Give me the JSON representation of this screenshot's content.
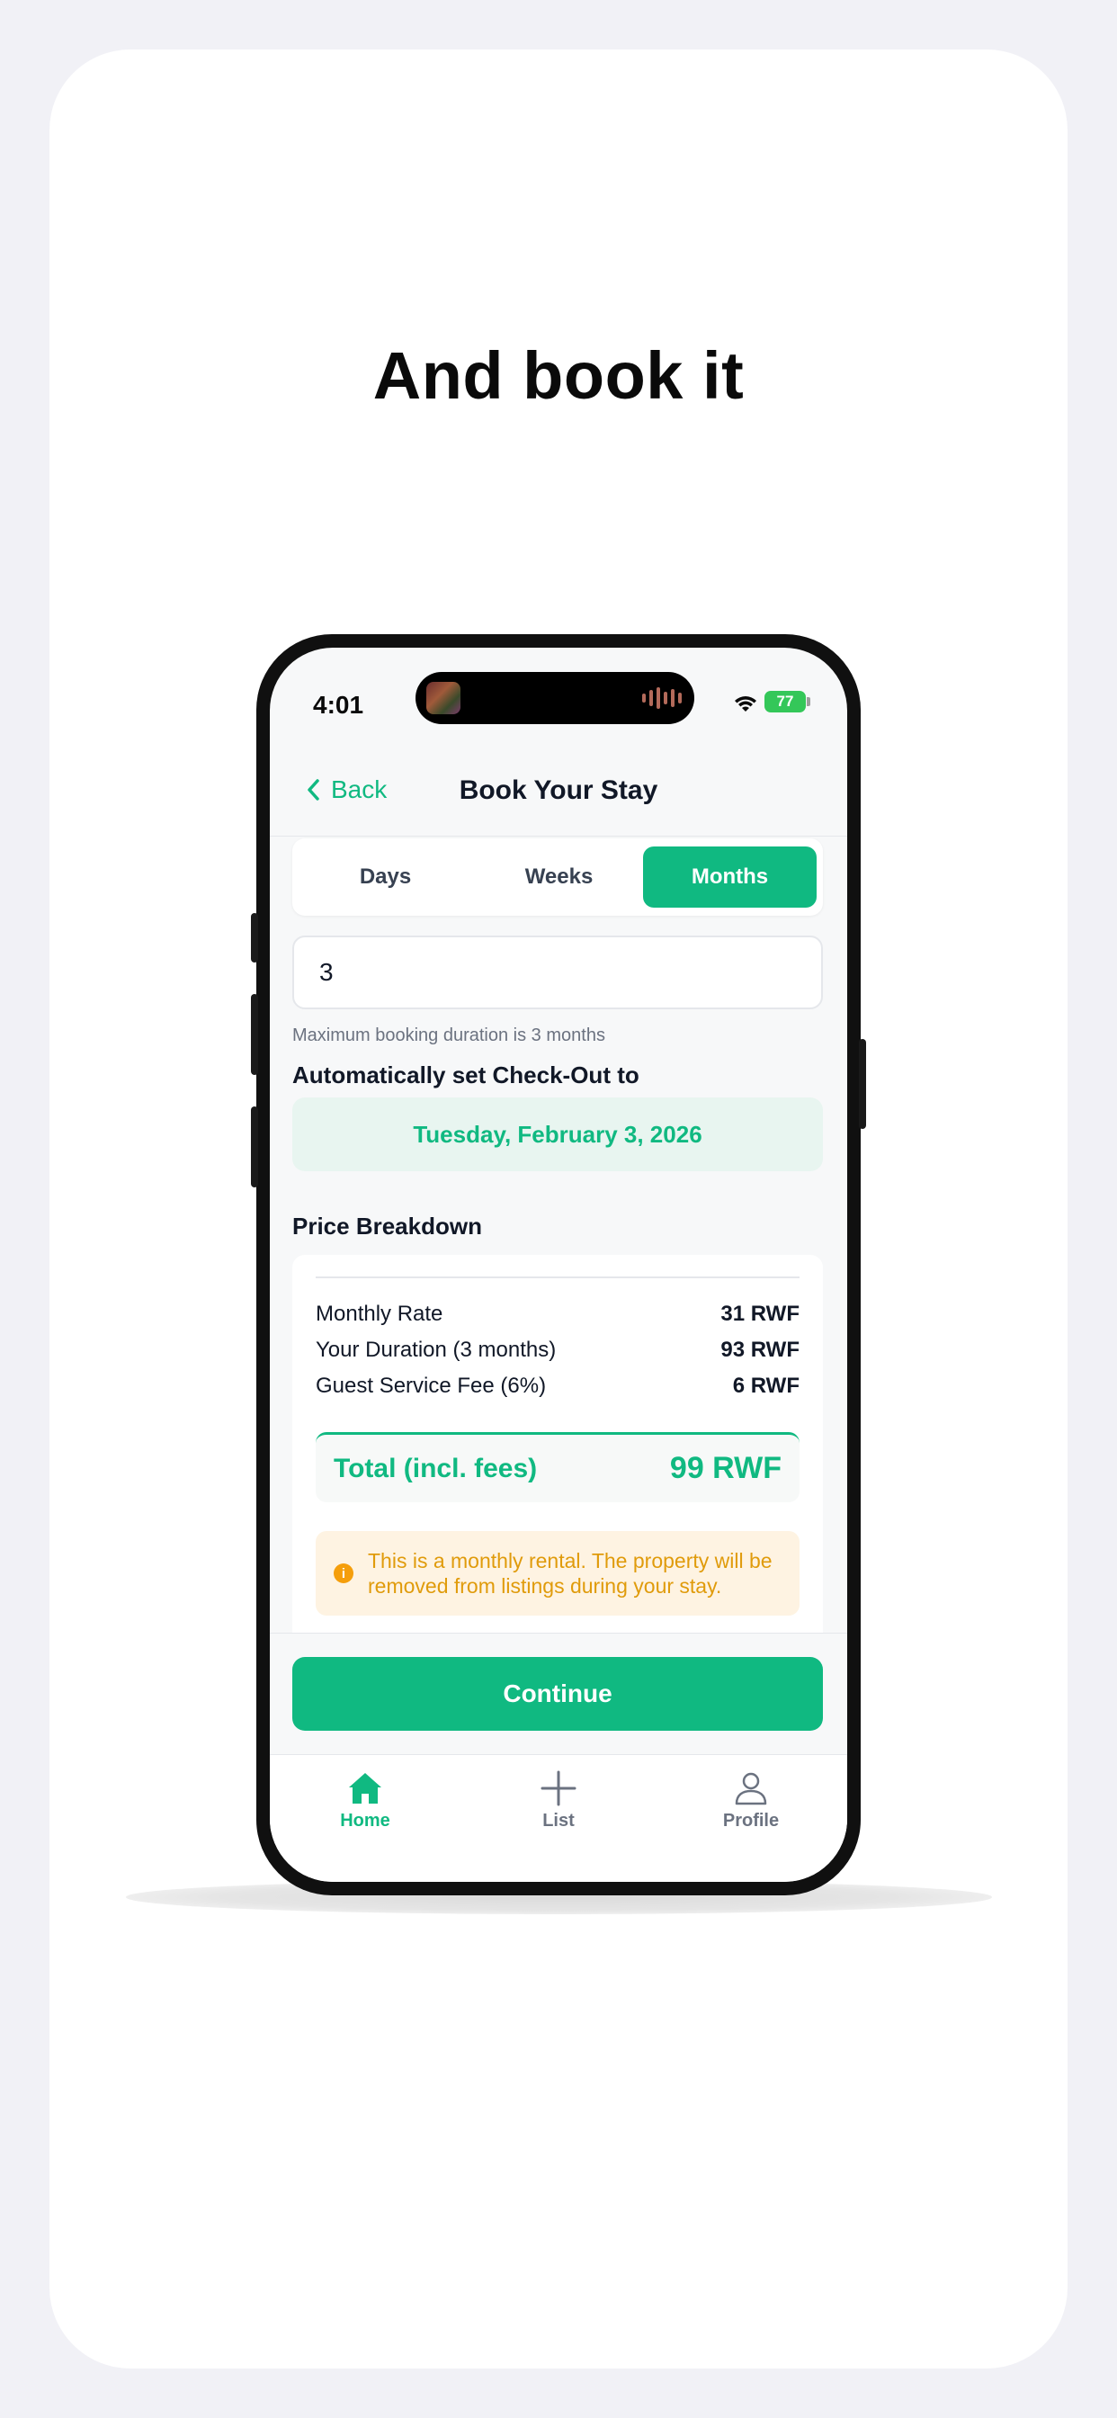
{
  "headline": "And book it",
  "status": {
    "time": "4:01",
    "battery": "77"
  },
  "nav": {
    "back_label": "Back",
    "title": "Book Your Stay"
  },
  "segments": [
    {
      "label": "Days",
      "active": false
    },
    {
      "label": "Weeks",
      "active": false
    },
    {
      "label": "Months",
      "active": true
    }
  ],
  "duration": {
    "value": "3",
    "hint": "Maximum booking duration is 3 months"
  },
  "checkout": {
    "label": "Automatically set Check-Out to",
    "date": "Tuesday, February 3, 2026"
  },
  "price": {
    "label": "Price Breakdown",
    "rows": [
      {
        "label": "Monthly Rate",
        "value": "31 RWF"
      },
      {
        "label": "Your Duration (3 months)",
        "value": "93 RWF"
      },
      {
        "label": "Guest Service Fee (6%)",
        "value": "6 RWF"
      }
    ],
    "total_label": "Total (incl. fees)",
    "total_value": "99 RWF",
    "notice": "This is a monthly rental. The property will be removed from listings during your stay."
  },
  "continue_label": "Continue",
  "tabs": [
    {
      "label": "Home",
      "icon": "home-icon",
      "active": true
    },
    {
      "label": "List",
      "icon": "plus-icon",
      "active": false
    },
    {
      "label": "Profile",
      "icon": "user-icon",
      "active": false
    }
  ],
  "colors": {
    "accent": "#10b981",
    "warning": "#f59e0b",
    "background": "#f1f1f6"
  }
}
